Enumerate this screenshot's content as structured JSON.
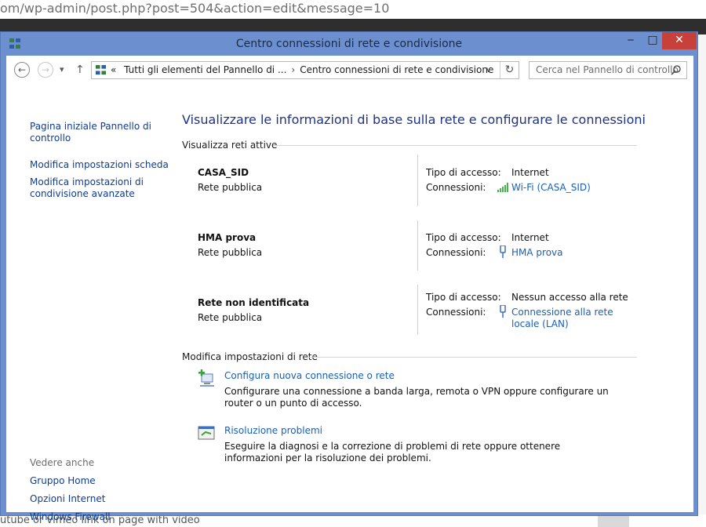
{
  "background": {
    "url_fragment": "om/wp-admin/post.php?post=504&action=edit&message=10",
    "bottom_text": "utube or vimeo link on page with video"
  },
  "window": {
    "title": "Centro connessioni di rete e condivisione",
    "controls": {
      "minimize": "‒",
      "maximize": "□",
      "close": "✕"
    }
  },
  "addressbar": {
    "back": "←",
    "forward": "→",
    "recent": "▾",
    "up": "↑",
    "crumb_prefix": "«",
    "crumbs": [
      "Tutti gli elementi del Pannello di ...",
      "Centro connessioni di rete e condivisione"
    ],
    "crumb_sep": "›",
    "dropdown": "∨",
    "refresh": "↻",
    "search_placeholder": "Cerca nel Pannello di controllo"
  },
  "left_pane": {
    "links": [
      "Pagina iniziale Pannello di controllo",
      "Modifica impostazioni scheda",
      "Modifica impostazioni di condivisione avanzate"
    ],
    "see_also_heading": "Vedere anche",
    "see_also": [
      "Gruppo Home",
      "Opzioni Internet",
      "Windows Firewall"
    ]
  },
  "main": {
    "title": "Visualizzare le informazioni di base sulla rete e configurare le connessioni",
    "active_heading": "Visualizza reti attive",
    "access_label": "Tipo di accesso:",
    "connections_label": "Connessioni:",
    "networks": [
      {
        "name": "CASA_SID",
        "category": "Rete pubblica",
        "access": "Internet",
        "connection": "Wi-Fi (CASA_SID)",
        "icon": "wifi-signal-icon"
      },
      {
        "name": "HMA prova",
        "category": "Rete pubblica",
        "access": "Internet",
        "connection": "HMA prova",
        "icon": "network-adapter-icon"
      },
      {
        "name": "Rete non identificata",
        "category": "Rete pubblica",
        "access": "Nessun accesso alla rete",
        "connection": "Connessione alla rete locale (LAN)",
        "icon": "network-adapter-icon"
      }
    ],
    "settings_heading": "Modifica impostazioni di rete",
    "tasks": [
      {
        "link": "Configura nuova connessione o rete",
        "desc": "Configurare una connessione a banda larga, remota o VPN oppure configurare un router o un punto di accesso.",
        "icon": "new-connection-icon"
      },
      {
        "link": "Risoluzione problemi",
        "desc": "Eseguire la diagnosi e la correzione di problemi di rete oppure ottenere informazioni per la risoluzione dei problemi.",
        "icon": "troubleshoot-icon"
      }
    ]
  },
  "colors": {
    "window_frame": "#6b8fcf",
    "link": "#1a5fb4",
    "title": "#1e3287",
    "close": "#c7403a"
  }
}
